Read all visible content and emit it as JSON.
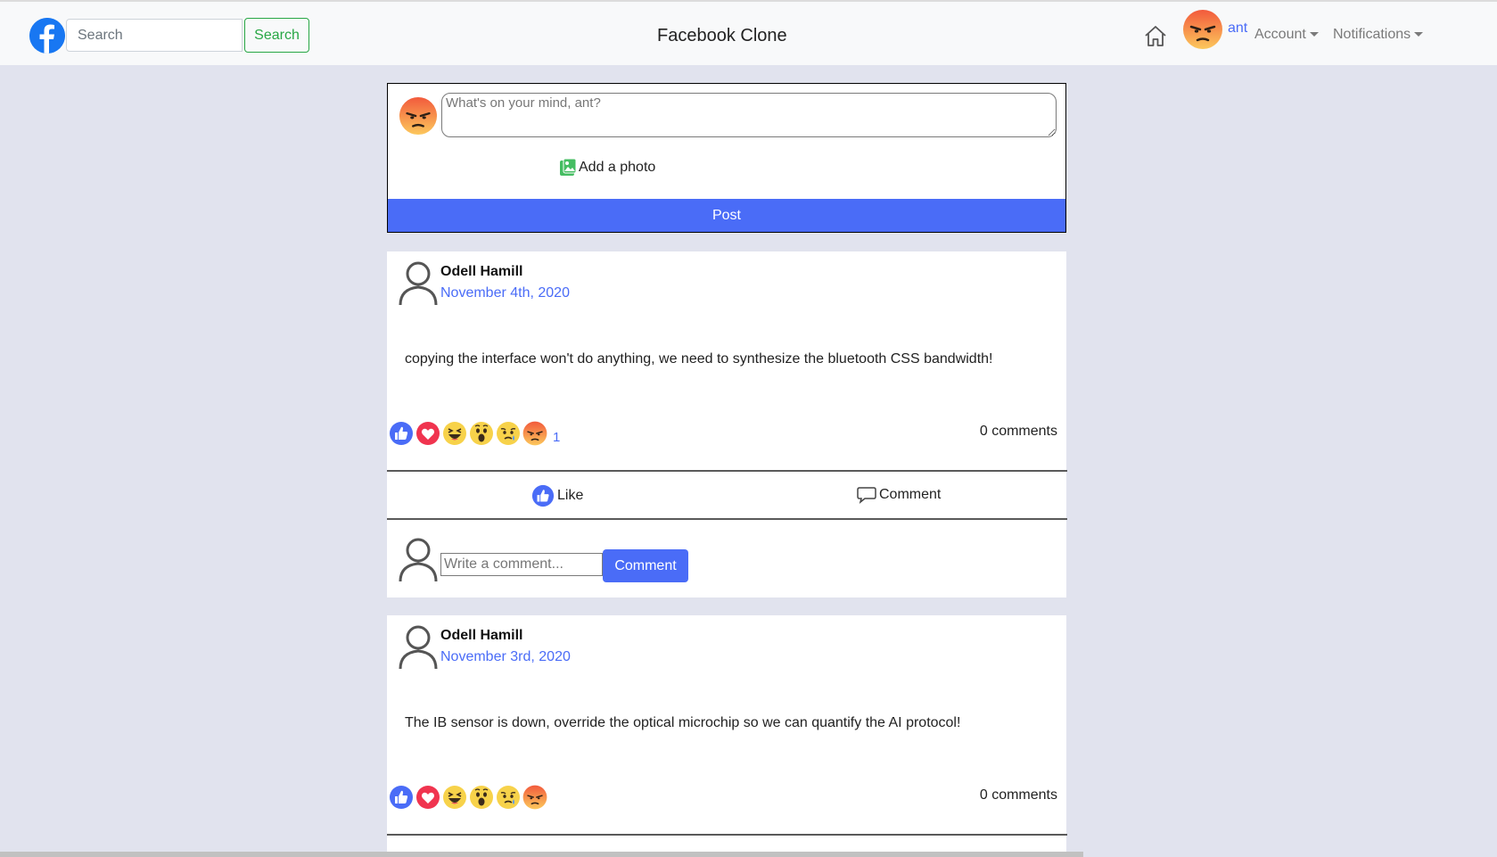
{
  "navbar": {
    "search_placeholder": "Search",
    "search_button": "Search",
    "brand": "Facebook Clone",
    "username": "ant",
    "account_label": "Account",
    "notifications_label": "Notifications"
  },
  "composer": {
    "placeholder": "What's on your mind, ant?",
    "add_photo": "Add a photo",
    "post_button": "Post"
  },
  "posts": [
    {
      "author": "Odell Hamill",
      "date": "November 4th, 2020",
      "body": "copying the interface won't do anything, we need to synthesize the bluetooth CSS bandwidth!",
      "reaction_count": "1",
      "comments_count": "0 comments",
      "like_label": "Like",
      "comment_label": "Comment",
      "comment_placeholder": "Write a comment...",
      "comment_button": "Comment"
    },
    {
      "author": "Odell Hamill",
      "date": "November 3rd, 2020",
      "body": "The IB sensor is down, override the optical microchip so we can quantify the AI protocol!",
      "comments_count": "0 comments"
    }
  ],
  "icons": [
    "facebook-logo-icon",
    "home-icon",
    "angry-avatar-icon",
    "photo-icon",
    "user-outline-icon",
    "like-icon",
    "comment-icon",
    "love-icon",
    "haha-icon",
    "wow-icon",
    "sad-icon",
    "angry-icon"
  ],
  "colors": {
    "accent": "#4a6cf7",
    "success": "#28a745",
    "background": "#e1e3ee",
    "facebook_blue": "#1877f2"
  }
}
